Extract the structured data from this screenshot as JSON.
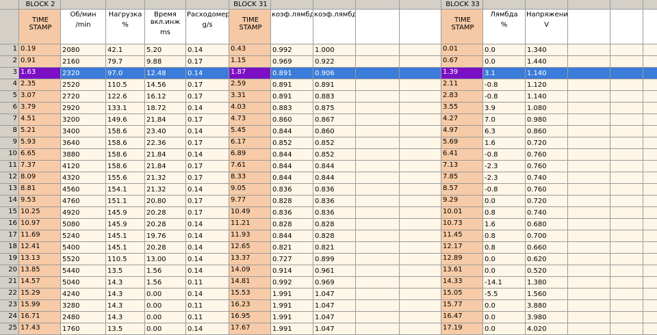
{
  "block_labels": {
    "b1": "BLOCK 2",
    "b2": "BLOCK 31",
    "b3": "BLOCK 33"
  },
  "headers": {
    "timestamp": "TIME STAMP",
    "rpm": {
      "title": "Об/мин",
      "unit": "/min"
    },
    "load": {
      "title": "Нагрузка",
      "unit": "%"
    },
    "inj": {
      "title": "Время вкл.инж",
      "unit": "ms"
    },
    "flow": {
      "title": "Расходомер",
      "unit": "g/s"
    },
    "lambda_coef1": {
      "title": "коэф.лямбда",
      "unit": ""
    },
    "lambda_coef2": {
      "title": "коэф.лямбда",
      "unit": ""
    },
    "lambda": {
      "title": "Лямбда",
      "unit": "%"
    },
    "voltage": {
      "title": "Напряжение",
      "unit": "V"
    }
  },
  "selected_row": 3,
  "rows": [
    {
      "n": "1",
      "t1": "0.19",
      "rpm": "2080",
      "load": "42.1",
      "inj": "5.20",
      "flow": "0.14",
      "t2": "0.43",
      "k1": "0.992",
      "k2": "1.000",
      "t3": "0.01",
      "lam": "0.0",
      "v": "1.340"
    },
    {
      "n": "2",
      "t1": "0.91",
      "rpm": "2160",
      "load": "79.7",
      "inj": "9.88",
      "flow": "0.17",
      "t2": "1.15",
      "k1": "0.969",
      "k2": "0.922",
      "t3": "0.67",
      "lam": "0.0",
      "v": "1.440"
    },
    {
      "n": "3",
      "t1": "1.63",
      "rpm": "2320",
      "load": "97.0",
      "inj": "12.48",
      "flow": "0.14",
      "t2": "1.87",
      "k1": "0.891",
      "k2": "0.906",
      "t3": "1.39",
      "lam": "3.1",
      "v": "1.140"
    },
    {
      "n": "4",
      "t1": "2.35",
      "rpm": "2520",
      "load": "110.5",
      "inj": "14.56",
      "flow": "0.17",
      "t2": "2.59",
      "k1": "0.891",
      "k2": "0.891",
      "t3": "2.11",
      "lam": "-0.8",
      "v": "1.120"
    },
    {
      "n": "5",
      "t1": "3.07",
      "rpm": "2720",
      "load": "122.6",
      "inj": "16.12",
      "flow": "0.17",
      "t2": "3.31",
      "k1": "0.891",
      "k2": "0.883",
      "t3": "2.83",
      "lam": "-0.8",
      "v": "1.140"
    },
    {
      "n": "6",
      "t1": "3.79",
      "rpm": "2920",
      "load": "133.1",
      "inj": "18.72",
      "flow": "0.14",
      "t2": "4.03",
      "k1": "0.883",
      "k2": "0.875",
      "t3": "3.55",
      "lam": "3.9",
      "v": "1.080"
    },
    {
      "n": "7",
      "t1": "4.51",
      "rpm": "3200",
      "load": "149.6",
      "inj": "21.84",
      "flow": "0.17",
      "t2": "4.73",
      "k1": "0.860",
      "k2": "0.867",
      "t3": "4.27",
      "lam": "7.0",
      "v": "0.980"
    },
    {
      "n": "8",
      "t1": "5.21",
      "rpm": "3400",
      "load": "158.6",
      "inj": "23.40",
      "flow": "0.14",
      "t2": "5.45",
      "k1": "0.844",
      "k2": "0.860",
      "t3": "4.97",
      "lam": "6.3",
      "v": "0.860"
    },
    {
      "n": "9",
      "t1": "5.93",
      "rpm": "3640",
      "load": "158.6",
      "inj": "22.36",
      "flow": "0.17",
      "t2": "6.17",
      "k1": "0.852",
      "k2": "0.852",
      "t3": "5.69",
      "lam": "1.6",
      "v": "0.720"
    },
    {
      "n": "10",
      "t1": "6.65",
      "rpm": "3880",
      "load": "158.6",
      "inj": "21.84",
      "flow": "0.14",
      "t2": "6.89",
      "k1": "0.844",
      "k2": "0.852",
      "t3": "6.41",
      "lam": "-0.8",
      "v": "0.760"
    },
    {
      "n": "11",
      "t1": "7.37",
      "rpm": "4120",
      "load": "158.6",
      "inj": "21.84",
      "flow": "0.17",
      "t2": "7.61",
      "k1": "0.844",
      "k2": "0.844",
      "t3": "7.13",
      "lam": "-2.3",
      "v": "0.760"
    },
    {
      "n": "12",
      "t1": "8.09",
      "rpm": "4320",
      "load": "155.6",
      "inj": "21.32",
      "flow": "0.17",
      "t2": "8.33",
      "k1": "0.844",
      "k2": "0.844",
      "t3": "7.85",
      "lam": "-2.3",
      "v": "0.740"
    },
    {
      "n": "13",
      "t1": "8.81",
      "rpm": "4560",
      "load": "154.1",
      "inj": "21.32",
      "flow": "0.14",
      "t2": "9.05",
      "k1": "0.836",
      "k2": "0.836",
      "t3": "8.57",
      "lam": "-0.8",
      "v": "0.760"
    },
    {
      "n": "14",
      "t1": "9.53",
      "rpm": "4760",
      "load": "151.1",
      "inj": "20.80",
      "flow": "0.17",
      "t2": "9.77",
      "k1": "0.828",
      "k2": "0.836",
      "t3": "9.29",
      "lam": "0.0",
      "v": "0.720"
    },
    {
      "n": "15",
      "t1": "10.25",
      "rpm": "4920",
      "load": "145.9",
      "inj": "20.28",
      "flow": "0.17",
      "t2": "10.49",
      "k1": "0.836",
      "k2": "0.836",
      "t3": "10.01",
      "lam": "0.8",
      "v": "0.740"
    },
    {
      "n": "16",
      "t1": "10.97",
      "rpm": "5080",
      "load": "145.9",
      "inj": "20.28",
      "flow": "0.14",
      "t2": "11.21",
      "k1": "0.828",
      "k2": "0.828",
      "t3": "10.73",
      "lam": "1.6",
      "v": "0.680"
    },
    {
      "n": "17",
      "t1": "11.69",
      "rpm": "5240",
      "load": "145.1",
      "inj": "19.76",
      "flow": "0.14",
      "t2": "11.93",
      "k1": "0.844",
      "k2": "0.828",
      "t3": "11.45",
      "lam": "0.8",
      "v": "0.700"
    },
    {
      "n": "18",
      "t1": "12.41",
      "rpm": "5400",
      "load": "145.1",
      "inj": "20.28",
      "flow": "0.14",
      "t2": "12.65",
      "k1": "0.821",
      "k2": "0.821",
      "t3": "12.17",
      "lam": "0.8",
      "v": "0.660"
    },
    {
      "n": "19",
      "t1": "13.13",
      "rpm": "5520",
      "load": "110.5",
      "inj": "13.00",
      "flow": "0.14",
      "t2": "13.37",
      "k1": "0.727",
      "k2": "0.899",
      "t3": "12.89",
      "lam": "0.0",
      "v": "0.620"
    },
    {
      "n": "20",
      "t1": "13.85",
      "rpm": "5440",
      "load": "13.5",
      "inj": "1.56",
      "flow": "0.14",
      "t2": "14.09",
      "k1": "0.914",
      "k2": "0.961",
      "t3": "13.61",
      "lam": "0.0",
      "v": "0.520"
    },
    {
      "n": "21",
      "t1": "14.57",
      "rpm": "5040",
      "load": "14.3",
      "inj": "1.56",
      "flow": "0.11",
      "t2": "14.81",
      "k1": "0.992",
      "k2": "0.969",
      "t3": "14.33",
      "lam": "-14.1",
      "v": "1.380"
    },
    {
      "n": "22",
      "t1": "15.29",
      "rpm": "4240",
      "load": "14.3",
      "inj": "0.00",
      "flow": "0.14",
      "t2": "15.53",
      "k1": "1.991",
      "k2": "1.047",
      "t3": "15.05",
      "lam": "-5.5",
      "v": "1.560"
    },
    {
      "n": "23",
      "t1": "15.99",
      "rpm": "3280",
      "load": "14.3",
      "inj": "0.00",
      "flow": "0.11",
      "t2": "16.23",
      "k1": "1.991",
      "k2": "1.047",
      "t3": "15.77",
      "lam": "0.0",
      "v": "3.880"
    },
    {
      "n": "24",
      "t1": "16.71",
      "rpm": "2480",
      "load": "14.3",
      "inj": "0.00",
      "flow": "0.11",
      "t2": "16.95",
      "k1": "1.991",
      "k2": "1.047",
      "t3": "16.47",
      "lam": "0.0",
      "v": "3.980"
    },
    {
      "n": "25",
      "t1": "17.43",
      "rpm": "1760",
      "load": "13.5",
      "inj": "0.00",
      "flow": "0.14",
      "t2": "17.67",
      "k1": "1.991",
      "k2": "1.047",
      "t3": "17.19",
      "lam": "0.0",
      "v": "4.020"
    }
  ]
}
